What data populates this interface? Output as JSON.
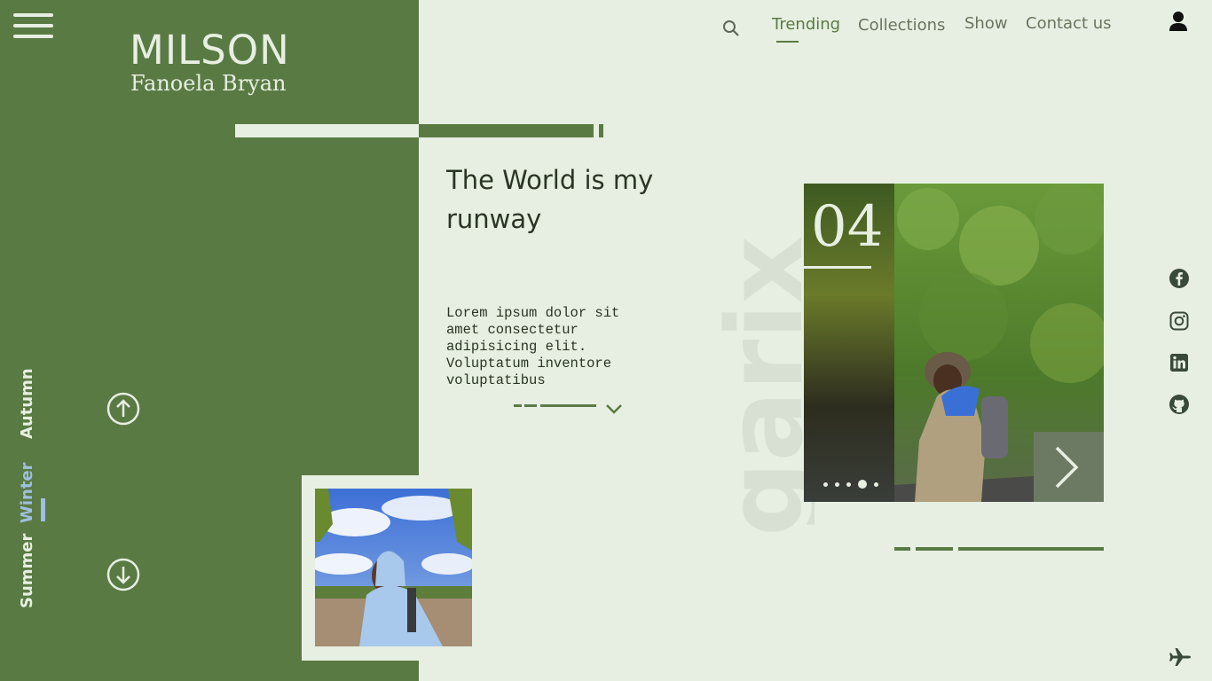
{
  "brand": {
    "title": "MILSON",
    "subtitle": "Fanoela Bryan"
  },
  "nav": {
    "items": [
      {
        "label": "Trending",
        "active": true
      },
      {
        "label": "Collections",
        "active": false
      },
      {
        "label": "Show",
        "active": false
      },
      {
        "label": "Contact us",
        "active": false
      }
    ]
  },
  "seasons": [
    {
      "label": "Autumn",
      "active": false
    },
    {
      "label": "Winter",
      "active": true
    },
    {
      "label": "Summer",
      "active": false
    }
  ],
  "hero": {
    "headline": "The World is my runway",
    "body": "Lorem ipsum dolor sit amet consectetur adipisicing elit. Voluptatum inventore voluptatibus"
  },
  "watermark": "garix",
  "slider": {
    "counter": "04",
    "dot_count": 5,
    "active_dot": 4
  },
  "icons": {
    "menu": "hamburger-menu-icon",
    "search": "search-icon",
    "user": "user-icon",
    "scroll_up": "arrow-up-circle-icon",
    "scroll_down": "arrow-down-circle-icon",
    "expand": "chevron-down-icon",
    "next": "chevron-right-icon",
    "social": [
      "facebook-icon",
      "instagram-icon",
      "linkedin-icon",
      "github-icon"
    ],
    "travel": "airplane-icon"
  },
  "colors": {
    "primary_green": "#5a7a44",
    "background": "#e6efe1",
    "text_dark": "#2a3525",
    "nav_gray": "#6a7560",
    "active_season": "#9fbfe0"
  }
}
